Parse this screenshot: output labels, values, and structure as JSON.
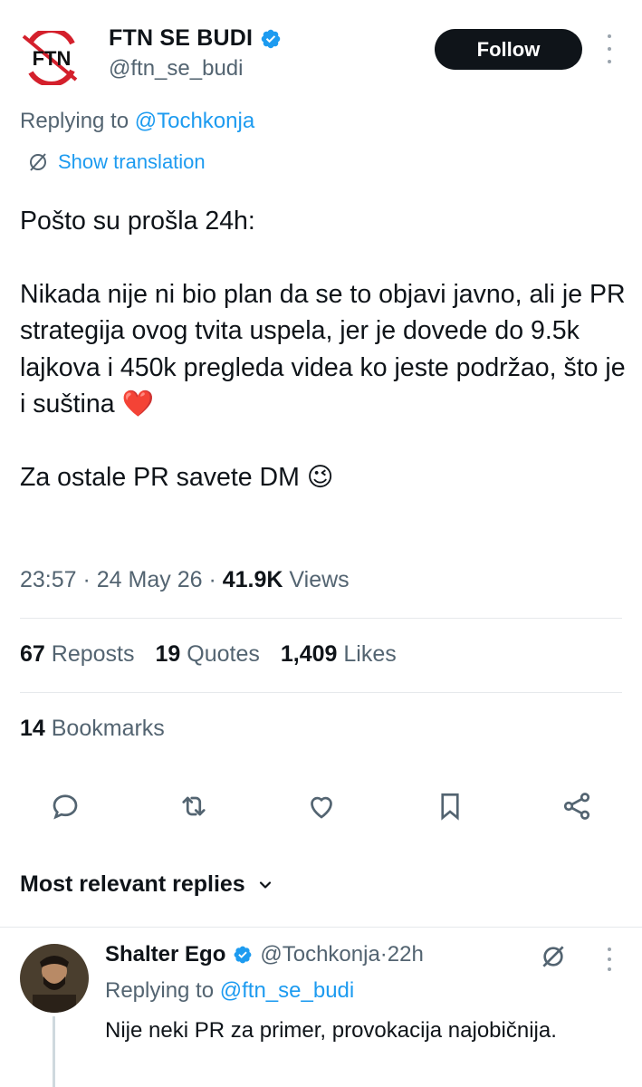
{
  "author": {
    "display_name": "FTN SE BUDI",
    "handle": "@ftn_se_budi",
    "verified": true,
    "logo_text": "FTN"
  },
  "follow_label": "Follow",
  "replying": {
    "prefix": "Replying to ",
    "handle": "@Tochkonja"
  },
  "show_translation": "Show translation",
  "tweet": {
    "line1": "Pošto su prošla 24h:",
    "paragraph2": "Nikada nije ni bio plan da se to objavi javno, ali je PR strategija ovog tvita uspela, jer je dovede do 9.5k lajkova i 450k pregleda videa ko jeste podržao, što je i suština ❤️",
    "paragraph3": "Za ostale PR savete DM 😉"
  },
  "meta": {
    "time": "23:57",
    "sep1": " · ",
    "date": "24 May 26",
    "sep2": " · ",
    "views_count": "41.9K",
    "views_label": " Views"
  },
  "stats": {
    "reposts_count": "67",
    "reposts_label": " Reposts",
    "quotes_count": "19",
    "quotes_label": " Quotes",
    "likes_count": "1,409",
    "likes_label": " Likes",
    "bookmarks_count": "14",
    "bookmarks_label": " Bookmarks"
  },
  "actions": [
    "reply-icon",
    "repost-icon",
    "like-icon",
    "bookmark-icon",
    "share-icon"
  ],
  "replies_sort": "Most relevant replies",
  "reply": {
    "name": "Shalter Ego",
    "handle": "@Tochkonja",
    "separator": " · ",
    "time": "22h",
    "replying_prefix": "Replying to ",
    "replying_handle": "@ftn_se_budi",
    "text": "Nije neki PR za primer, provokacija najobičnija."
  },
  "colors": {
    "accent": "#1d9bf0",
    "text": "#0f1419",
    "secondary": "#536471",
    "logo_red": "#d4202c"
  }
}
